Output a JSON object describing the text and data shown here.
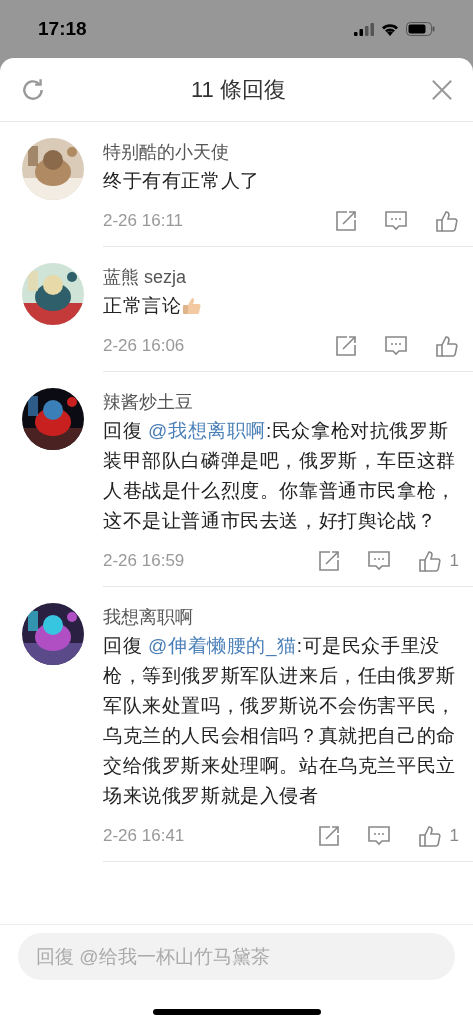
{
  "status_bar": {
    "time": "17:18"
  },
  "header": {
    "title": "11 條回復"
  },
  "comments": [
    {
      "author": "特别酷的小天使",
      "body": {
        "text": "终于有有正常人了"
      },
      "time": "2-26 16:11"
    },
    {
      "author": "蓝熊 sezja",
      "body": {
        "text": "正常言论",
        "thumbs_up_emoji": true
      },
      "time": "2-26 16:06"
    },
    {
      "author": "辣酱炒土豆",
      "body": {
        "prefix": "回復",
        "mention": "@我想离职啊",
        "text": ":民众拿枪对抗俄罗斯装甲部队白磷弹是吧，俄罗斯，车臣这群人巷战是什么烈度。你靠普通市民拿枪，这不是让普通市民去送，好打舆论战？"
      },
      "time": "2-26 16:59",
      "likes": "1"
    },
    {
      "author": "我想离职啊",
      "body": {
        "prefix": "回復",
        "mention": "@伸着懒腰的_猫",
        "text": ":可是民众手里没枪，等到俄罗斯军队进来后，任由俄罗斯军队来处置吗，俄罗斯说不会伤害平民，乌克兰的人民会相信吗？真就把自己的命交给俄罗斯来处理啊。站在乌克兰平民立场来说俄罗斯就是入侵者"
      },
      "time": "2-26 16:41",
      "likes": "1"
    }
  ],
  "reply_field": {
    "placeholder": "回復 @给我一杯山竹马黛茶"
  }
}
